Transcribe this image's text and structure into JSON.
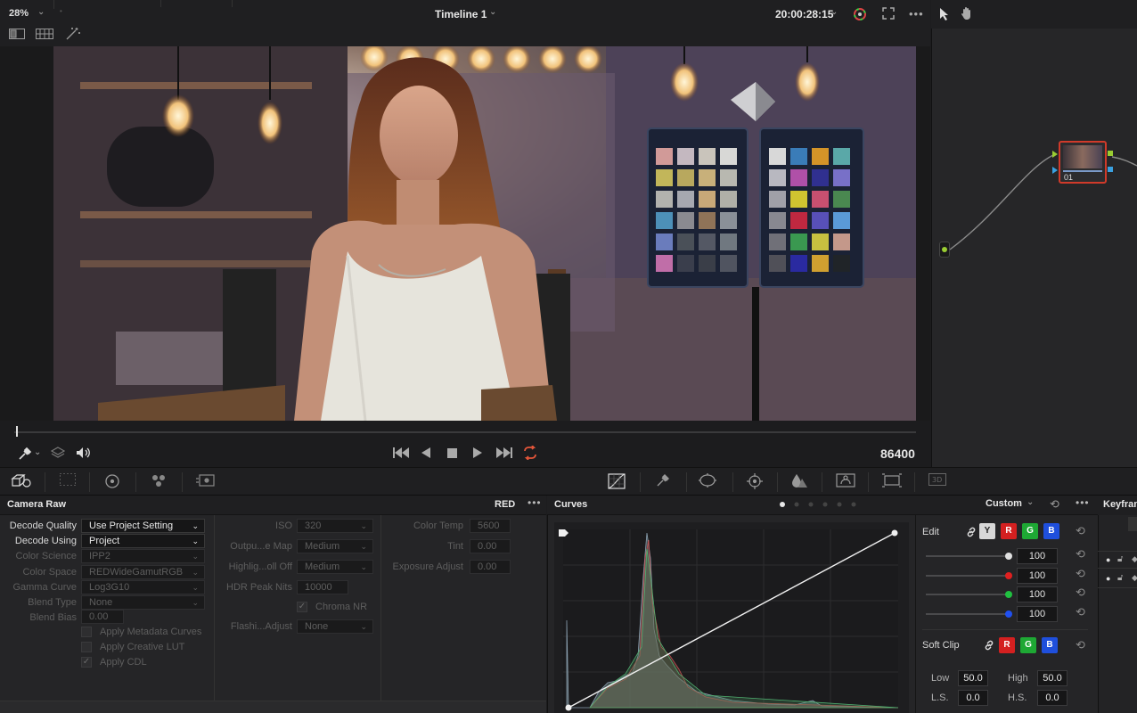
{
  "viewer": {
    "zoom": "28%",
    "timeline_title": "Timeline 1",
    "timecode": "20:00:28:15",
    "frame_count": "86400"
  },
  "node": {
    "label": "01"
  },
  "camera_raw": {
    "title": "Camera Raw",
    "format": "RED",
    "col1": [
      {
        "label": "Decode Quality",
        "value": "Use Project Setting",
        "enabled": true
      },
      {
        "label": "Decode Using",
        "value": "Project",
        "enabled": true
      },
      {
        "label": "Color Science",
        "value": "IPP2",
        "enabled": false
      },
      {
        "label": "Color Space",
        "value": "REDWideGamutRGB",
        "enabled": false
      },
      {
        "label": "Gamma Curve",
        "value": "Log3G10",
        "enabled": false
      },
      {
        "label": "Blend Type",
        "value": "None",
        "enabled": false
      }
    ],
    "blend_bias": {
      "label": "Blend Bias",
      "value": "0.00"
    },
    "checks": [
      {
        "label": "Apply Metadata Curves",
        "checked": false
      },
      {
        "label": "Apply Creative LUT",
        "checked": false
      },
      {
        "label": "Apply CDL",
        "checked": true
      }
    ],
    "col2": [
      {
        "label": "ISO",
        "value": "320"
      },
      {
        "label": "Outpu...e Map",
        "value": "Medium"
      },
      {
        "label": "Highlig...oll Off",
        "value": "Medium"
      }
    ],
    "hdr_peak": {
      "label": "HDR Peak Nits",
      "value": "10000"
    },
    "chroma_nr": {
      "label": "Chroma NR",
      "checked": true
    },
    "flash": {
      "label": "Flashi...Adjust",
      "value": "None"
    },
    "col3": [
      {
        "label": "Color Temp",
        "value": "5600"
      },
      {
        "label": "Tint",
        "value": "0.00"
      },
      {
        "label": "Exposure Adjust",
        "value": "0.00"
      }
    ]
  },
  "curves": {
    "title": "Curves",
    "mode": "Custom",
    "edit_label": "Edit",
    "channels": [
      "Y",
      "R",
      "G",
      "B"
    ],
    "intensities": [
      "100",
      "100",
      "100",
      "100"
    ],
    "soft_clip_label": "Soft Clip",
    "low_label": "Low",
    "low_value": "50.0",
    "high_label": "High",
    "high_value": "50.0",
    "ls_label": "L.S.",
    "ls_value": "0.0",
    "hs_label": "H.S.",
    "hs_value": "0.0"
  },
  "keyframes": {
    "title": "Keyframes"
  },
  "colors": {
    "accent_red": "#e23232",
    "accent_orange": "#e5563a",
    "y_chip": "#d8d8d8",
    "r_chip": "#d42020",
    "g_chip": "#1ea834",
    "b_chip": "#1f4fdc"
  }
}
